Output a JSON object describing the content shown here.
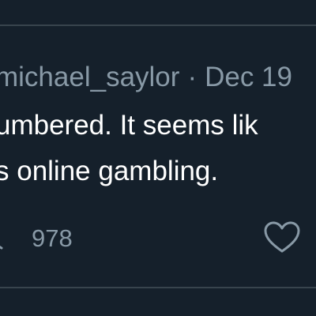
{
  "tweet": {
    "handle": "michael_saylor",
    "separator": "·",
    "date": "Dec 19",
    "text_line_1": "umbered.   It seems lik",
    "text_line_2": "s online gambling.",
    "count": "978"
  },
  "icons": {
    "like": "heart-outline-icon",
    "partial_action": "share-arrow-icon"
  },
  "colors": {
    "background": "#15202b",
    "divider": "#38444d",
    "secondary_text": "#8899a6",
    "primary_text": "#ffffff"
  }
}
